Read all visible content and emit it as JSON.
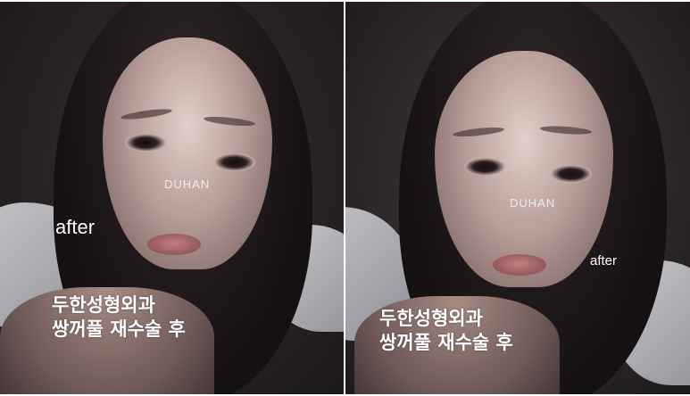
{
  "panels": [
    {
      "watermark": "DUHAN",
      "label": "after",
      "caption_line1": "두한성형외과",
      "caption_line2": "쌍꺼풀 재수술 후"
    },
    {
      "watermark": "DUHAN",
      "label": "after",
      "caption_line1": "두한성형외과",
      "caption_line2": "쌍꺼풀 재수술 후"
    }
  ]
}
